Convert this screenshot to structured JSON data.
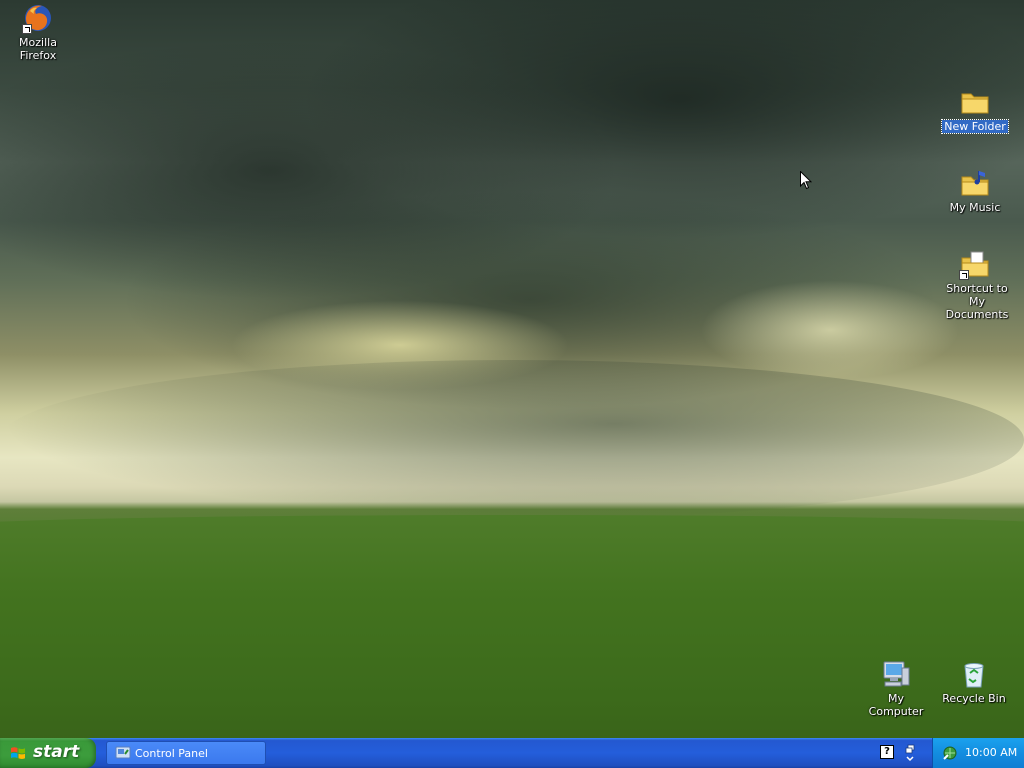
{
  "desktop": {
    "icons": [
      {
        "label": "Mozilla Firefox",
        "selected": false
      },
      {
        "label": "New Folder",
        "selected": true
      },
      {
        "label": "My Music",
        "selected": false
      },
      {
        "label": "Shortcut to My Documents",
        "selected": false
      },
      {
        "label": "My Computer",
        "selected": false
      },
      {
        "label": "Recycle Bin",
        "selected": false
      }
    ]
  },
  "taskbar": {
    "start_label": "start",
    "tasks": [
      {
        "label": "Control Panel",
        "icon": "control-panel-icon"
      }
    ],
    "tray": {
      "help_label": "?",
      "clock": "10:00 AM"
    }
  },
  "colors": {
    "taskbar": "#245edb",
    "start": "#3c9c3c",
    "tray": "#138de0",
    "selection": "#316ac5"
  }
}
